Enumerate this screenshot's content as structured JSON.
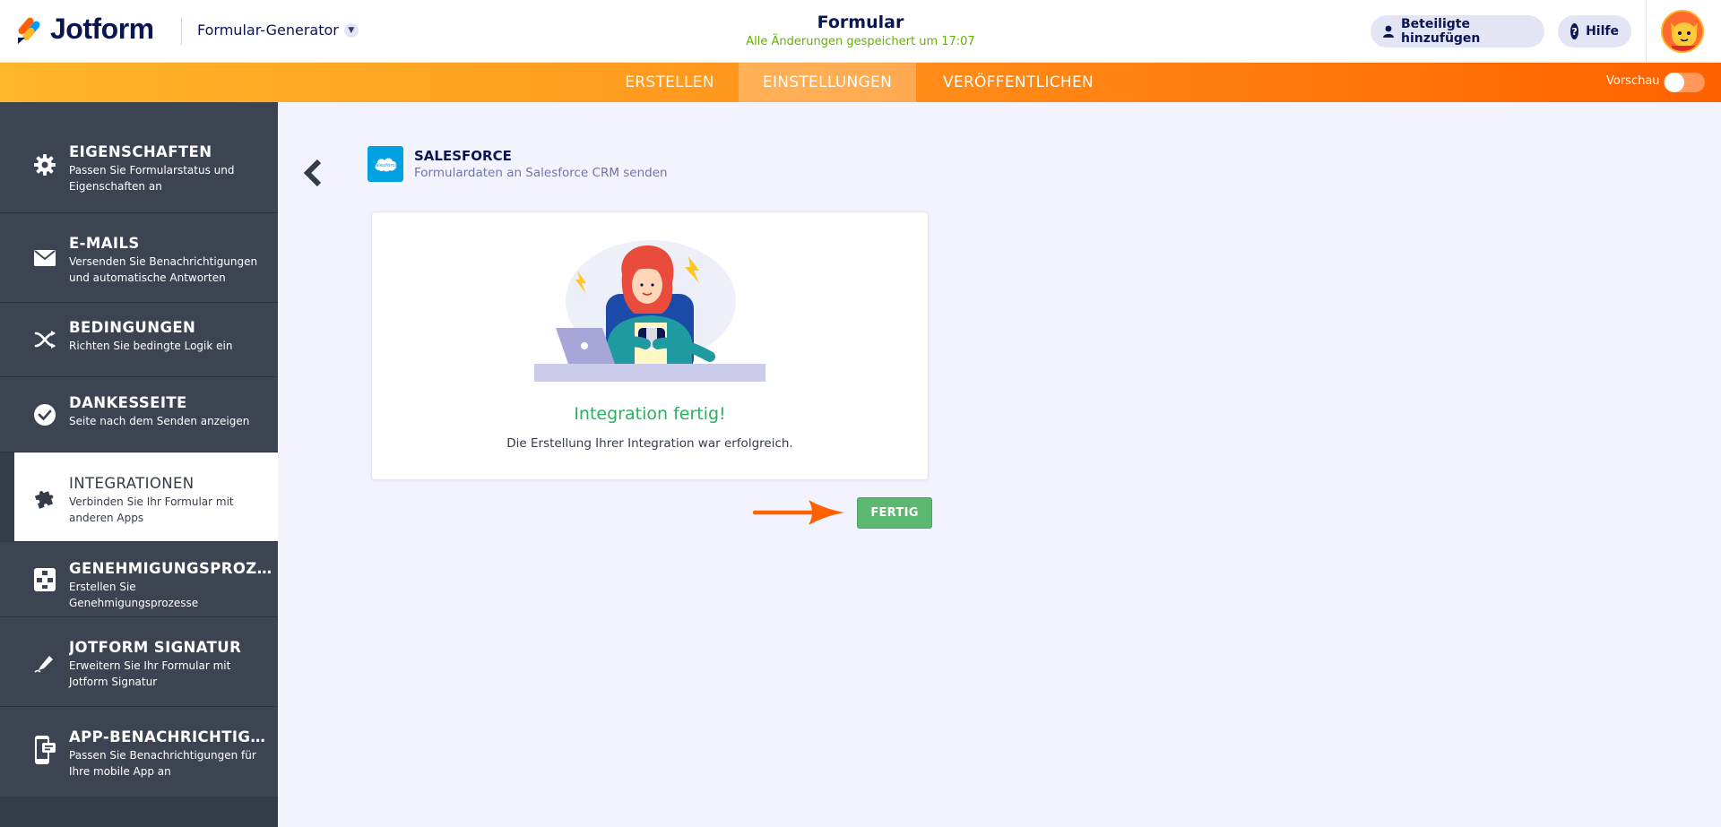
{
  "header": {
    "brand": "Jotform",
    "generator_label": "Formular-Generator",
    "form_title": "Formular",
    "saved_status": "Alle Änderungen gespeichert um 17:07",
    "add_participants_label": "Beteiligte hinzufügen",
    "help_label": "Hilfe"
  },
  "nav": {
    "tabs": [
      {
        "label": "ERSTELLEN"
      },
      {
        "label": "EINSTELLUNGEN"
      },
      {
        "label": "VERÖFFENTLICHEN"
      }
    ],
    "preview_label": "Vorschau"
  },
  "sidebar": {
    "items": [
      {
        "title": "EIGENSCHAFTEN",
        "desc": "Passen Sie Formularstatus und Eigenschaften an",
        "icon": "gear-icon"
      },
      {
        "title": "E-MAILS",
        "desc": "Versenden Sie Benachrichtigungen und automatische Antworten",
        "icon": "mail-icon"
      },
      {
        "title": "BEDINGUNGEN",
        "desc": "Richten Sie bedingte Logik ein",
        "icon": "shuffle-icon"
      },
      {
        "title": "DANKESSEITE",
        "desc": "Seite nach dem Senden anzeigen",
        "icon": "check-circle-icon"
      },
      {
        "title": "INTEGRATIONEN",
        "desc": "Verbinden Sie Ihr Formular mit anderen Apps",
        "icon": "puzzle-icon"
      },
      {
        "title": "GENEHMIGUNGSPROZESSE",
        "desc": "Erstellen Sie Genehmigungsprozesse",
        "icon": "flow-icon"
      },
      {
        "title": "JOTFORM SIGNATUR",
        "desc": "Erweitern Sie Ihr Formular mit Jotform Signatur",
        "icon": "pen-icon"
      },
      {
        "title": "APP-BENACHRICHTIGUNG",
        "desc": "Passen Sie Benachrichtigungen für Ihre mobile App an",
        "icon": "mobile-icon"
      }
    ],
    "active_index": 4
  },
  "integration": {
    "name": "SALESFORCE",
    "description": "Formulardaten an Salesforce CRM senden",
    "logo_text": "salesforce",
    "success_title": "Integration fertig!",
    "success_desc": "Die Erstellung Ihrer Integration war erfolgreich.",
    "done_label": "FERTIG"
  },
  "colors": {
    "accent_orange": "#ff6100",
    "success_green": "#28b15e",
    "button_green": "#5cb770",
    "sidebar_bg": "#3d4451",
    "salesforce_blue": "#00a1e0"
  }
}
